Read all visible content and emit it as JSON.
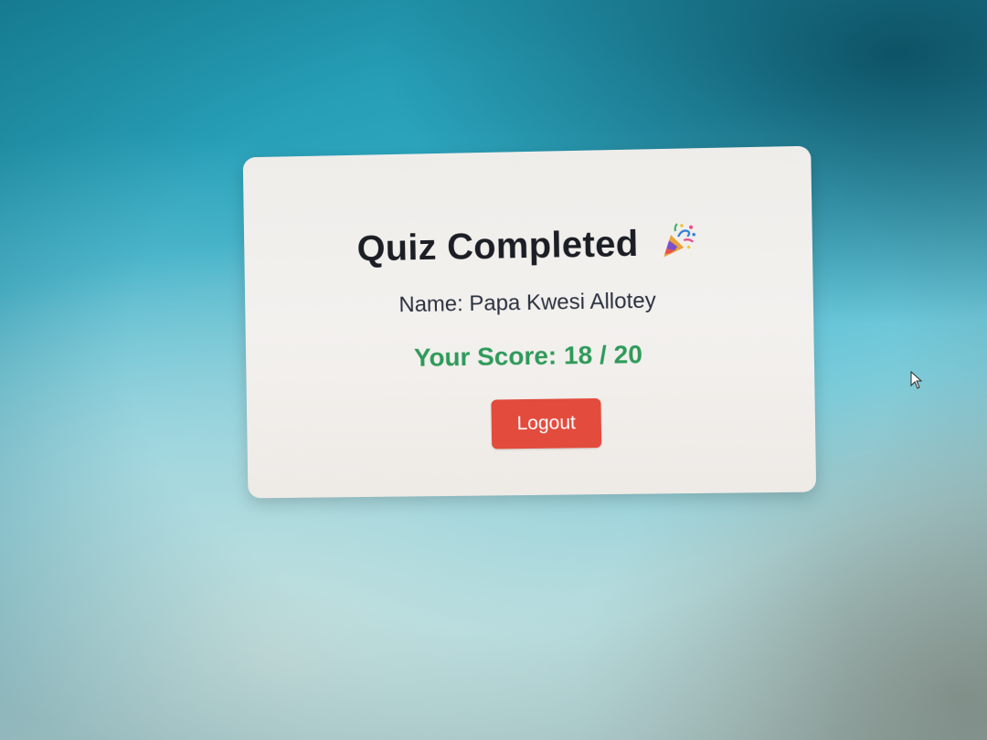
{
  "card": {
    "title": "Quiz Completed",
    "title_icon": "party-popper-icon",
    "name_line": "Name: Papa Kwesi Allotey",
    "score_line": "Your Score: 18 / 20",
    "logout_label": "Logout"
  },
  "colors": {
    "score_green": "#2f9a5a",
    "logout_red": "#e34b3d",
    "title_text": "#1b1e24"
  },
  "pointer": {
    "icon": "mouse-pointer-icon"
  }
}
